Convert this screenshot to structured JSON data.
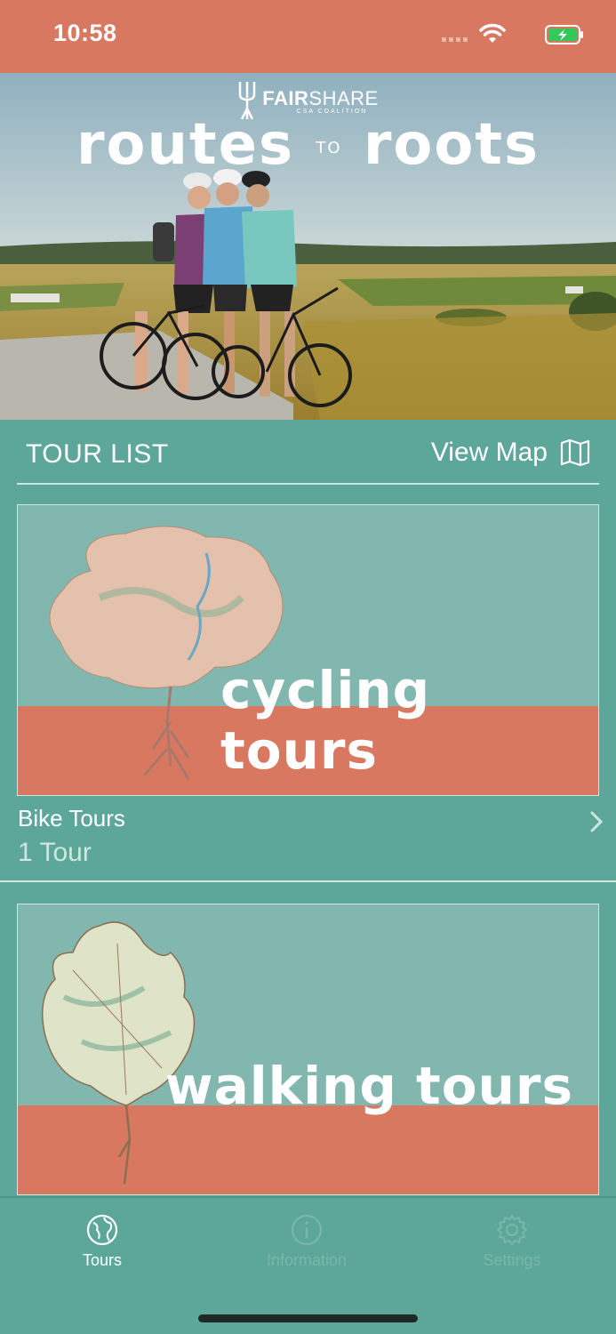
{
  "status_bar": {
    "time": "10:58"
  },
  "hero": {
    "brand_name_bold": "FAIR",
    "brand_name_rest": "SHARE",
    "brand_sub": "CSA COALITION",
    "title_left": "routes",
    "title_mid": "TO",
    "title_right": "roots"
  },
  "tour_list": {
    "title": "TOUR LIST",
    "view_map_label": "View Map"
  },
  "tours": [
    {
      "banner_text": "cycling tours",
      "name": "Bike Tours",
      "count": "1 Tour"
    },
    {
      "banner_text": "walking tours"
    }
  ],
  "tab_bar": {
    "tabs": [
      {
        "label": "Tours",
        "icon": "globe-icon",
        "active": true
      },
      {
        "label": "Information",
        "icon": "info-icon",
        "active": false
      },
      {
        "label": "Settings",
        "icon": "gear-icon",
        "active": false
      }
    ]
  },
  "colors": {
    "accent_coral": "#d97860",
    "teal_background": "#5da79a",
    "banner_teal": "#81b7ae"
  }
}
